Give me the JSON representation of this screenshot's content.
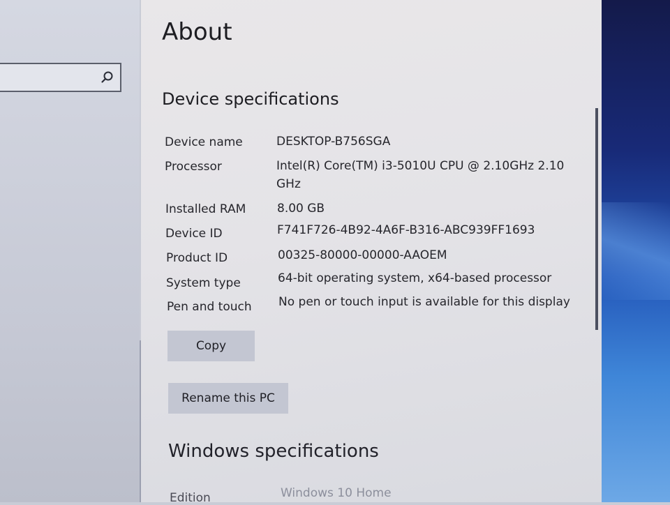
{
  "search": {
    "value": "",
    "placeholder": ""
  },
  "page": {
    "title": "About"
  },
  "device_specs": {
    "heading": "Device specifications",
    "rows": [
      {
        "label": "Device name",
        "value": "DESKTOP-B756SGA"
      },
      {
        "label": "Processor",
        "value": "Intel(R) Core(TM) i3-5010U CPU @ 2.10GHz   2.10 GHz"
      },
      {
        "label": "Installed RAM",
        "value": "8.00 GB"
      },
      {
        "label": "Device ID",
        "value": "F741F726-4B92-4A6F-B316-ABC939FF1693"
      },
      {
        "label": "Product ID",
        "value": "00325-80000-00000-AAOEM"
      },
      {
        "label": "System type",
        "value": "64-bit operating system, x64-based processor"
      },
      {
        "label": "Pen and touch",
        "value": "No pen or touch input is available for this display"
      }
    ],
    "copy_label": "Copy",
    "rename_label": "Rename this PC"
  },
  "windows_specs": {
    "heading": "Windows specifications",
    "edition_label": "Edition",
    "edition_value": "Windows 10 Home"
  },
  "icons": {
    "search": "search-icon"
  },
  "colors": {
    "content_bg": "#e6e5e8",
    "nav_bg": "#d0d3dd",
    "button_bg": "#c3c6d2",
    "wallpaper": "#1f4fb0"
  }
}
